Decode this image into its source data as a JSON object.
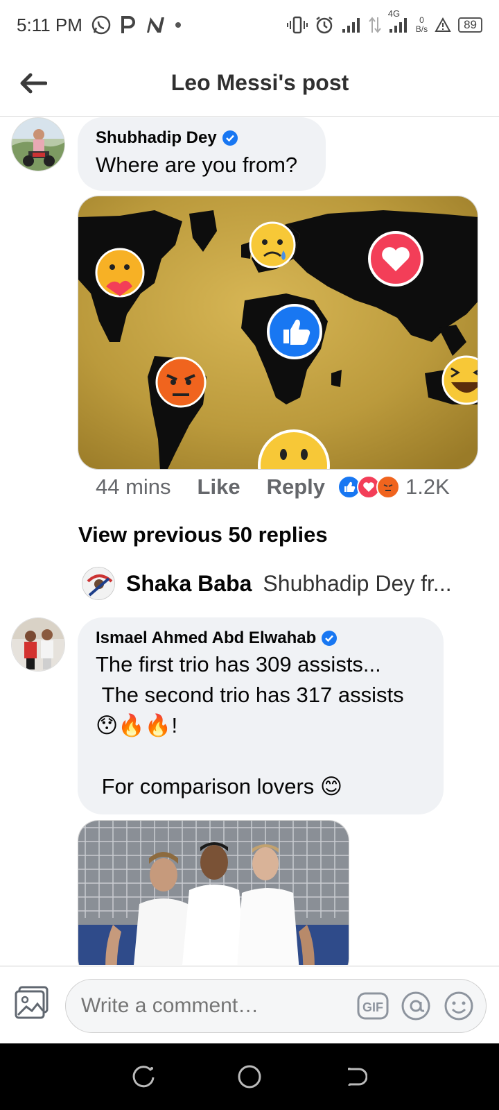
{
  "status_bar": {
    "time": "5:11 PM",
    "network_type": "4G",
    "data_rate_value": "0",
    "data_rate_unit": "B/s",
    "battery_level": "89"
  },
  "header": {
    "title": "Leo Messi's post"
  },
  "comment1": {
    "author": "Shubhadip Dey",
    "text": "Where are you from?",
    "time": "44 mins",
    "like_label": "Like",
    "reply_label": "Reply",
    "reaction_count": "1.2K"
  },
  "view_previous": "View previous 50 replies",
  "reply_preview": {
    "name": "Shaka Baba",
    "text": "Shubhadip Dey fr..."
  },
  "comment2": {
    "author": "Ismael Ahmed Abd Elwahab",
    "text": "The first trio has 309 assists...\n The second trio has 317 assists\n😯🔥🔥!\n\n For comparison lovers 😊"
  },
  "composer": {
    "placeholder": "Write a comment…"
  },
  "colors": {
    "accent": "#1877f2",
    "bubble": "#f0f2f5",
    "love": "#f33e58",
    "angry": "#e9710f",
    "gold": "#c9a440"
  }
}
